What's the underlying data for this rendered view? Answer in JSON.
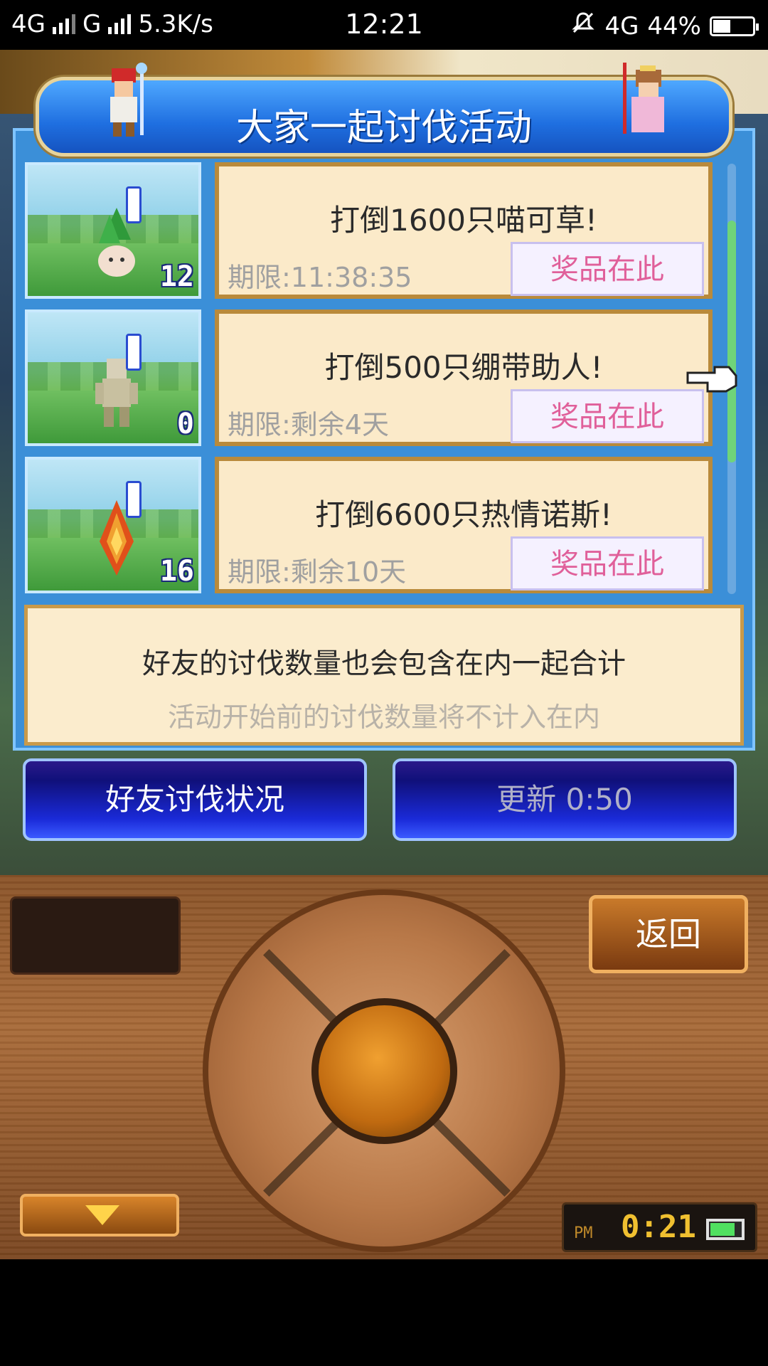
{
  "status_bar": {
    "network1": "4G",
    "network2": "G",
    "speed": "5.3K/s",
    "time": "12:21",
    "network3": "4G",
    "battery_percent": "44%",
    "battery_level": 0.44
  },
  "dialog": {
    "title": "大家一起讨伐活动",
    "events": [
      {
        "kill_count": "12",
        "title": "打倒1600只喵可草!",
        "deadline": "期限:11:38:35",
        "prize_label": "奖品在此"
      },
      {
        "kill_count": "0",
        "title": "打倒500只绷带助人!",
        "deadline": "期限:剩余4天",
        "prize_label": "奖品在此"
      },
      {
        "kill_count": "16",
        "title": "打倒6600只热情诺斯!",
        "deadline": "期限:剩余10天",
        "prize_label": "奖品在此"
      }
    ],
    "info_main": "好友的讨伐数量也会包含在内一起合计",
    "info_sub": "活动开始前的讨伐数量将不计入在内"
  },
  "buttons": {
    "friend_status": "好友讨伐状况",
    "refresh": "更新 0:50"
  },
  "control_pad": {
    "back_label": "返回",
    "clock_ampm": "PM",
    "clock_time": "0:21",
    "clock_battery_level": 0.8
  },
  "colors": {
    "dialog_blue": "#3b8fd8",
    "card_bg": "#fbeac9",
    "prize_text": "#e0609a",
    "button_blue": "#1a2ad8"
  }
}
